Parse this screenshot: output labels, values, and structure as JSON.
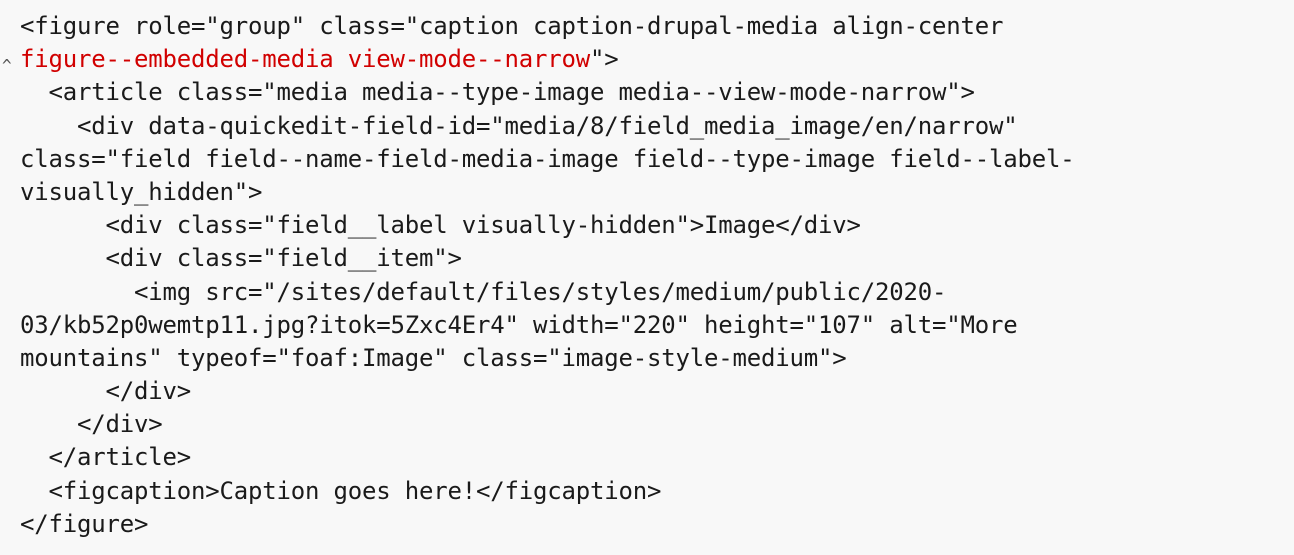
{
  "code": {
    "line1": "<figure role=\"group\" class=\"caption caption-drupal-media align-center",
    "line2_highlight": "figure--embedded-media view-mode--narrow",
    "line2_rest": "\">",
    "line3": "  <article class=\"media media--type-image media--view-mode-narrow\">",
    "line4": "    <div data-quickedit-field-id=\"media/8/field_media_image/en/narrow\"",
    "line5": "class=\"field field--name-field-media-image field--type-image field--label-",
    "line6": "visually_hidden\">",
    "line7": "      <div class=\"field__label visually-hidden\">Image</div>",
    "line8": "      <div class=\"field__item\">",
    "line9": "        <img src=\"/sites/default/files/styles/medium/public/2020-",
    "line10": "03/kb52p0wemtp11.jpg?itok=5Zxc4Er4\" width=\"220\" height=\"107\" alt=\"More",
    "line11": "mountains\" typeof=\"foaf:Image\" class=\"image-style-medium\">",
    "line12": "      </div>",
    "line13": "    </div>",
    "line14": "  </article>",
    "line15": "  <figcaption>Caption goes here!</figcaption>",
    "line16": "</figure>"
  },
  "colors": {
    "highlight": "#d10000",
    "text": "#1a1a1a",
    "background": "#f8f8f8"
  }
}
